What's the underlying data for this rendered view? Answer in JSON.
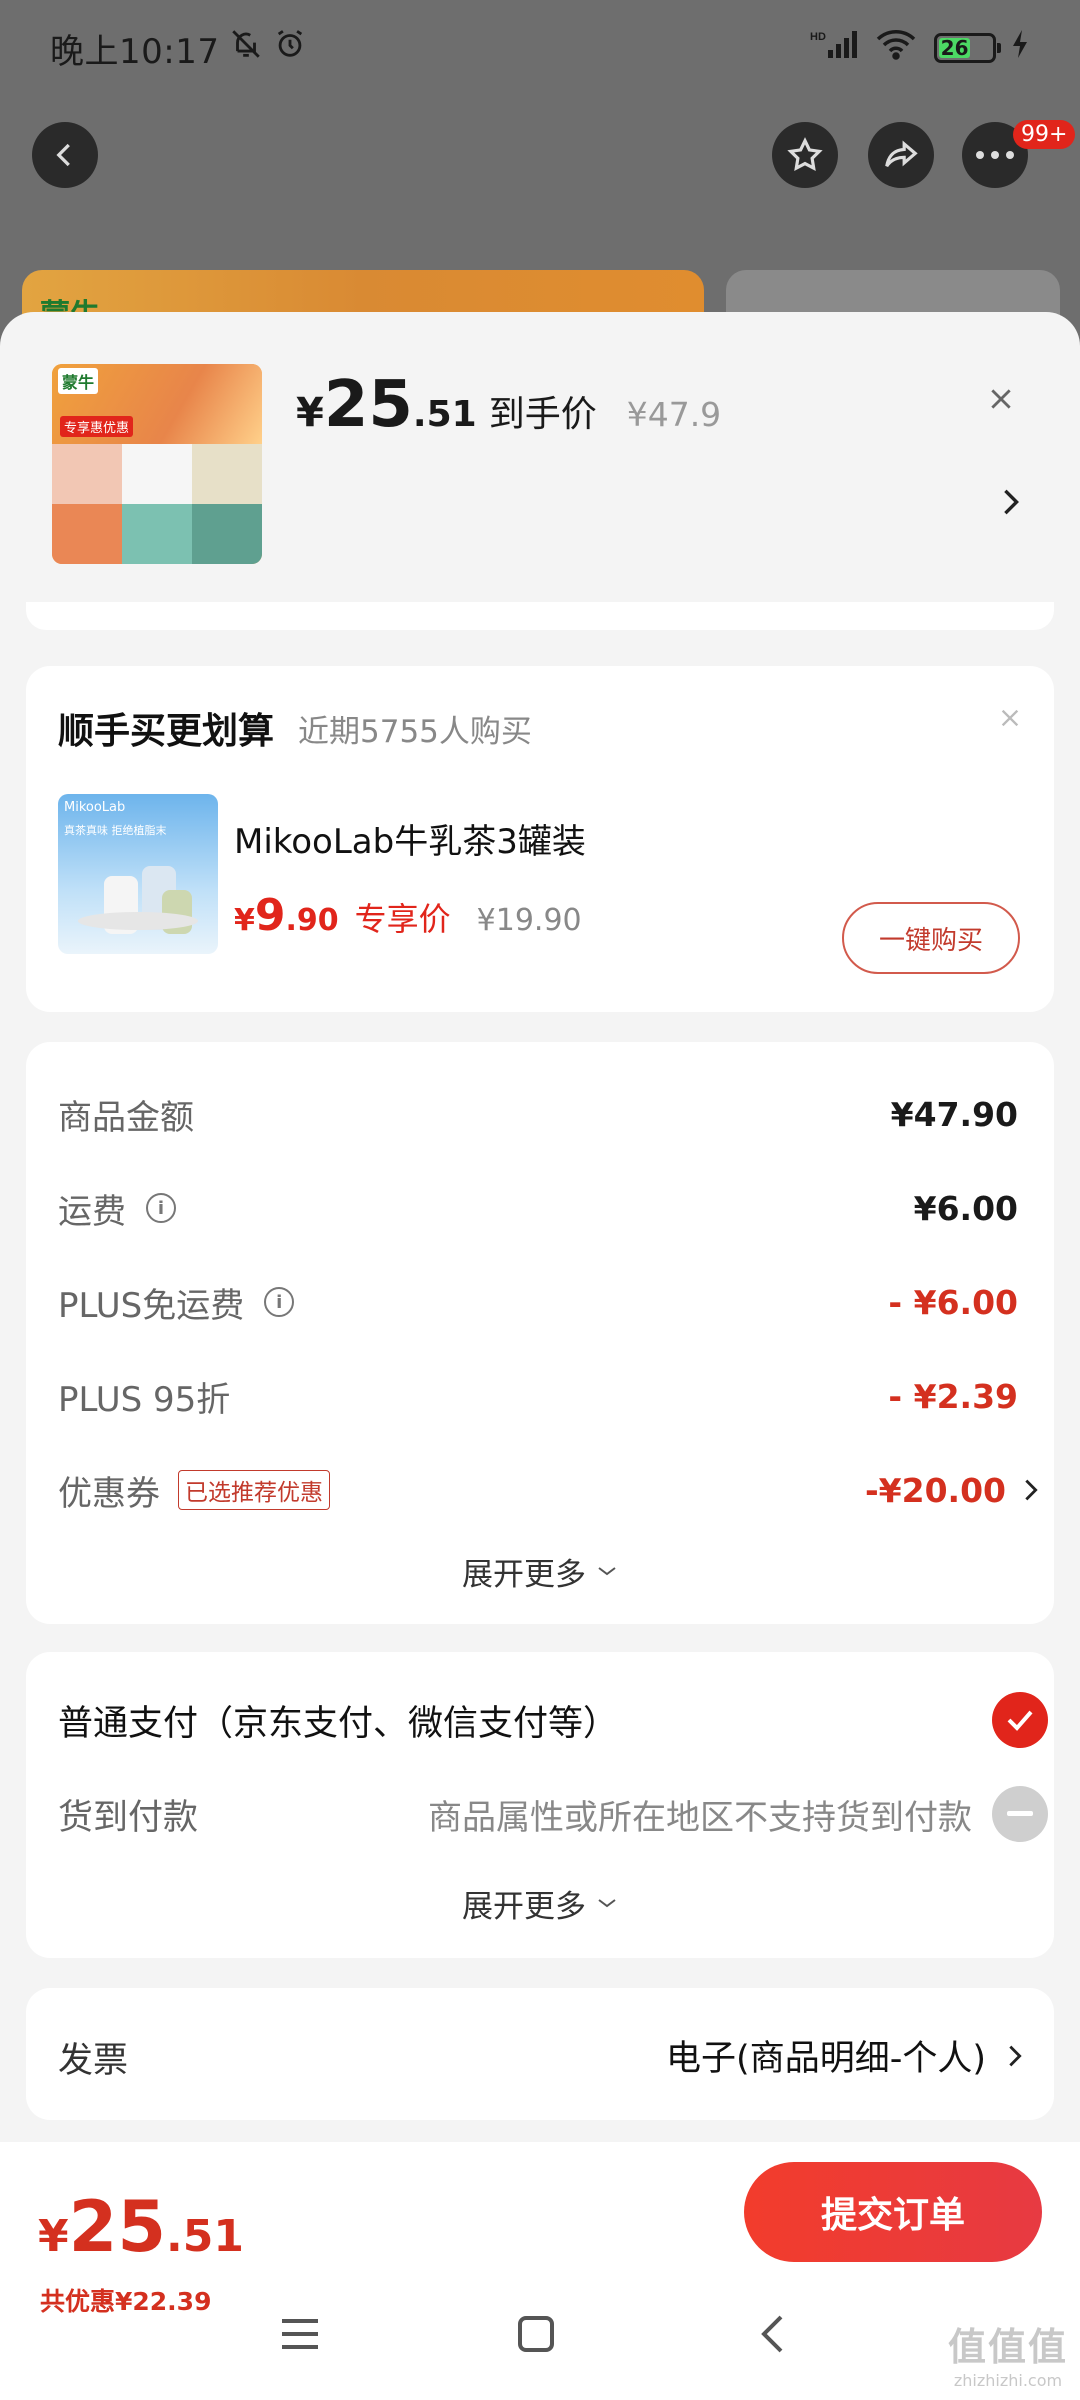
{
  "status_bar": {
    "time": "晚上10:17",
    "battery_level": 26,
    "battery_label": "26",
    "network": "HD",
    "wifi_label": "6"
  },
  "header": {
    "more_badge": "99+",
    "bg_brand": "蒙牛"
  },
  "product": {
    "thumb_brand": "蒙牛",
    "thumb_tag": "专享惠优惠",
    "price_yen": "¥",
    "price_int": "25",
    "price_dec": ".51",
    "price_label": "到手价",
    "orig_price": "¥47.9"
  },
  "upsell": {
    "title": "顺手买更划算",
    "subtitle": "近期5755人购买",
    "thumb_brand": "MikooLab",
    "thumb_text": "真茶真味 拒绝植脂末",
    "name": "MikooLab牛乳茶3罐装",
    "price_yen": "¥",
    "price_int": "9",
    "price_dec": ".90",
    "price_tag": "专享价",
    "orig_price": "¥19.90",
    "buy_label": "一键购买"
  },
  "fees": {
    "rows": [
      {
        "label": "商品金额",
        "value": "¥47.90"
      },
      {
        "label": "运费",
        "value": "¥6.00"
      },
      {
        "label": "PLUS免运费",
        "value": "- ¥6.00"
      },
      {
        "label": "PLUS 95折",
        "value": "- ¥2.39"
      },
      {
        "label": "优惠券",
        "value": "-¥20.00",
        "tag": "已选推荐优惠"
      }
    ],
    "expand_label": "展开更多"
  },
  "payment": {
    "options": [
      {
        "label": "普通支付（京东支付、微信支付等）",
        "selected": true
      },
      {
        "label": "货到付款",
        "hint": "商品属性或所在地区不支持货到付款",
        "selected": false
      }
    ],
    "expand_label": "展开更多"
  },
  "invoice": {
    "label": "发票",
    "value": "电子(商品明细-个人)"
  },
  "checkout": {
    "total_yen": "¥",
    "total_int": "25",
    "total_dec": ".51",
    "savings": "共优惠¥22.39",
    "submit_label": "提交订单"
  },
  "watermark": {
    "logo": "值值值",
    "url": "zhizhizhi.com"
  },
  "colors": {
    "accent_red": "#e1251b",
    "price_red": "#d4301f",
    "sheet_bg": "#f4f4f4"
  }
}
